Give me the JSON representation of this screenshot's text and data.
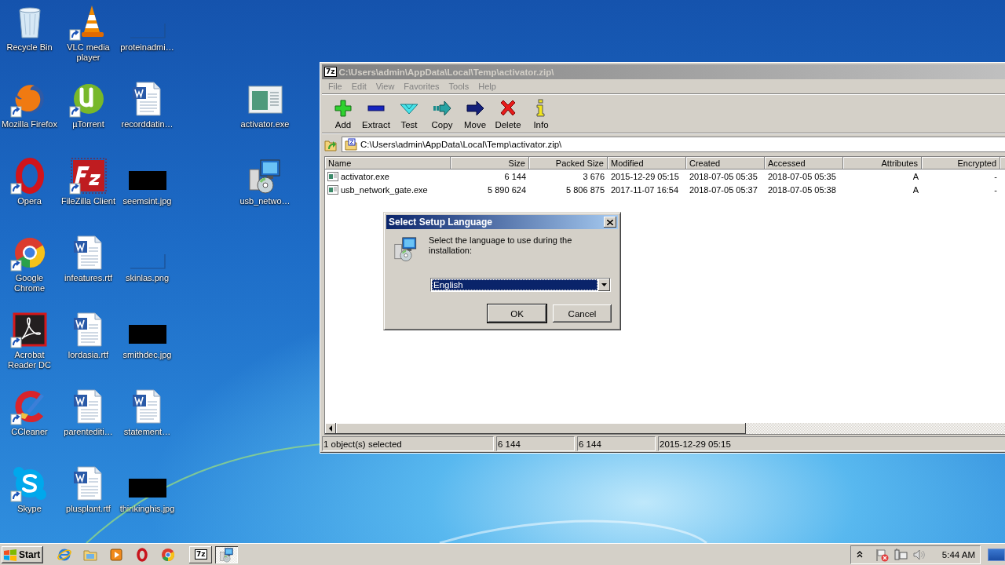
{
  "desktop": {
    "columns": [
      [
        {
          "label": "Recycle Bin",
          "kind": "recycle",
          "shortcut": false
        },
        {
          "label": "Mozilla Firefox",
          "kind": "globe",
          "shortcut": true
        },
        {
          "label": "Opera",
          "kind": "ring",
          "shortcut": true
        },
        {
          "label": "Google Chrome",
          "kind": "chrome",
          "shortcut": true
        },
        {
          "label": "Acrobat Reader DC",
          "kind": "acrobat",
          "shortcut": true
        },
        {
          "label": "CCleaner",
          "kind": "brush",
          "shortcut": true
        },
        {
          "label": "Skype",
          "kind": "skype",
          "shortcut": true
        }
      ],
      [
        {
          "label": "VLC media player",
          "kind": "cone",
          "shortcut": true
        },
        {
          "label": "µTorrent",
          "kind": "torrent",
          "shortcut": true
        },
        {
          "label": "FileZilla Client",
          "kind": "filezilla",
          "shortcut": true
        },
        {
          "label": "infeatures.rtf",
          "kind": "doc",
          "shortcut": false
        },
        {
          "label": "lordasia.rtf",
          "kind": "doc",
          "shortcut": false
        },
        {
          "label": "parentediti…",
          "kind": "doc",
          "shortcut": false
        },
        {
          "label": "plusplant.rtf",
          "kind": "doc",
          "shortcut": false
        }
      ],
      [
        {
          "label": "proteinadmi…",
          "kind": "blank",
          "shortcut": false
        },
        {
          "label": "recorddatin…",
          "kind": "doc",
          "shortcut": false
        },
        {
          "label": "seemsint.jpg",
          "kind": "dark",
          "shortcut": false
        },
        {
          "label": "skinlas.png",
          "kind": "blank",
          "shortcut": false
        },
        {
          "label": "smithdec.jpg",
          "kind": "dark",
          "shortcut": false
        },
        {
          "label": "statement…",
          "kind": "doc",
          "shortcut": false
        },
        {
          "label": "thinkinghis.jpg",
          "kind": "dark",
          "shortcut": false
        }
      ],
      [
        {
          "label": "activator.exe",
          "kind": "window",
          "shortcut": false
        },
        {
          "label": "usb_netwo…",
          "kind": "installer",
          "shortcut": false
        }
      ]
    ]
  },
  "window": {
    "title": "C:\\Users\\admin\\AppData\\Local\\Temp\\activator.zip\\",
    "app_badge": "7z",
    "active": false,
    "menu": [
      "File",
      "Edit",
      "View",
      "Favorites",
      "Tools",
      "Help"
    ],
    "toolbar": [
      {
        "label": "Add",
        "kind": "add"
      },
      {
        "label": "Extract",
        "kind": "extract"
      },
      {
        "label": "Test",
        "kind": "test"
      },
      {
        "label": "Copy",
        "kind": "copy"
      },
      {
        "label": "Move",
        "kind": "move"
      },
      {
        "label": "Delete",
        "kind": "delete"
      },
      {
        "label": "Info",
        "kind": "info"
      }
    ],
    "address": "C:\\Users\\admin\\AppData\\Local\\Temp\\activator.zip\\",
    "columns": [
      "Name",
      "Size",
      "Packed Size",
      "Modified",
      "Created",
      "Accessed",
      "Attributes",
      "Encrypted"
    ],
    "rows": [
      [
        "activator.exe",
        "6 144",
        "3 676",
        "2015-12-29 05:15",
        "2018-07-05 05:35",
        "2018-07-05 05:35",
        "A",
        "-"
      ],
      [
        "usb_network_gate.exe",
        "5 890 624",
        "5 806 875",
        "2017-11-07 16:54",
        "2018-07-05 05:37",
        "2018-07-05 05:38",
        "A",
        "-"
      ]
    ],
    "status_bar": [
      "1 object(s) selected",
      "6 144",
      "6 144",
      "2015-12-29 05:15"
    ]
  },
  "dialog": {
    "title": "Select Setup Language",
    "message": "Select the language to use during the installation:",
    "language": "English",
    "buttons": [
      {
        "label": "OK",
        "default": true
      },
      {
        "label": "Cancel",
        "default": false
      }
    ]
  },
  "taskbar": {
    "start": "Start",
    "quick_launch": [
      {
        "kind": "ie"
      },
      {
        "kind": "folder"
      },
      {
        "kind": "media"
      },
      {
        "kind": "ring"
      },
      {
        "kind": "chrome"
      }
    ],
    "tasks": [
      {
        "kind": "badge",
        "label": "7z",
        "selected": false
      },
      {
        "kind": "installer",
        "selected": true
      }
    ],
    "tray": [
      {
        "kind": "chevron"
      },
      {
        "kind": "flag"
      },
      {
        "kind": "network"
      },
      {
        "kind": "speaker"
      }
    ],
    "clock": "5:44 AM"
  }
}
